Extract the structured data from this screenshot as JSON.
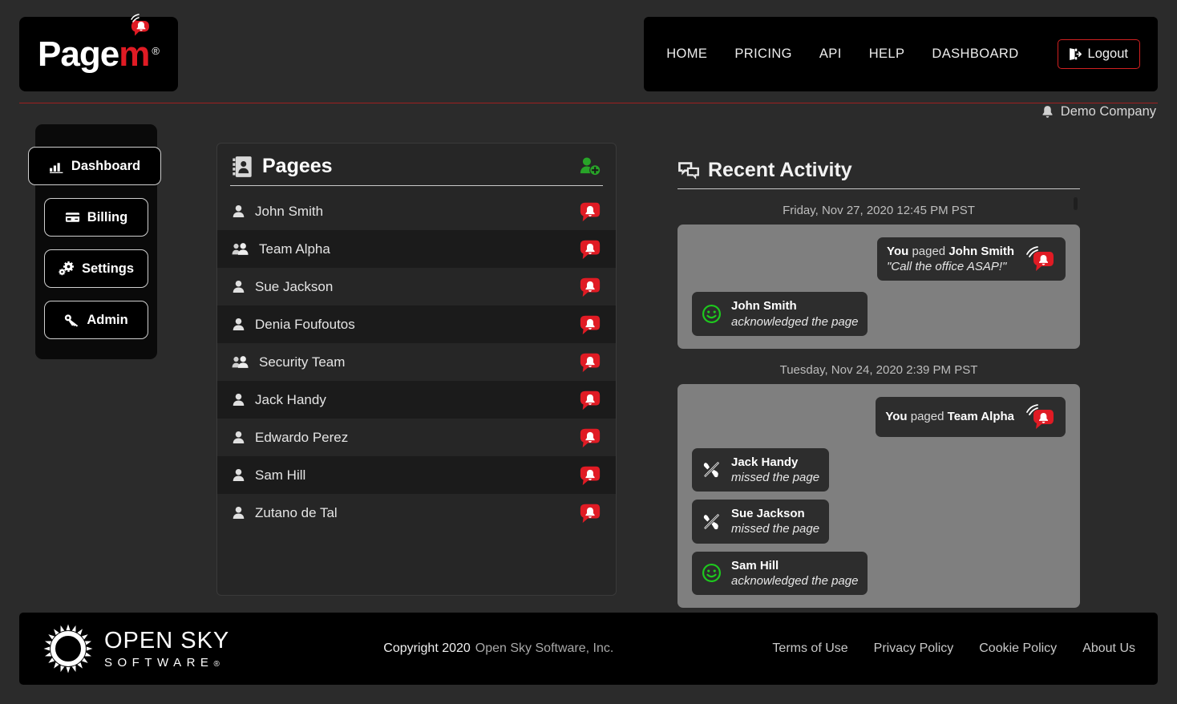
{
  "brand": {
    "logo_text": "Page",
    "logo_accent": "m",
    "logo_registered": "®",
    "accent_color": "#e01b24"
  },
  "nav": {
    "links": [
      {
        "label": "HOME"
      },
      {
        "label": "PRICING"
      },
      {
        "label": "API"
      },
      {
        "label": "HELP"
      },
      {
        "label": "DASHBOARD"
      }
    ],
    "logout_label": "Logout",
    "logout_icon": "sign-out-icon",
    "logout_border_color": "#d02020"
  },
  "account": {
    "bell_icon": "bell-icon",
    "company": "Demo Company"
  },
  "sidebar": {
    "items": [
      {
        "label": "Dashboard",
        "icon": "chart-bar-icon",
        "active": true
      },
      {
        "label": "Billing",
        "icon": "credit-card-icon",
        "active": false
      },
      {
        "label": "Settings",
        "icon": "gears-icon",
        "active": false
      },
      {
        "label": "Admin",
        "icon": "key-icon",
        "active": false
      }
    ]
  },
  "pagees": {
    "title": "Pagees",
    "title_icon": "address-book-icon",
    "add_icon": "add-user-icon",
    "add_icon_color": "#28a428",
    "page_icon": "page-bell-bubble-icon",
    "page_icon_color": "#e01b24",
    "rows": [
      {
        "name": "John Smith",
        "type": "user"
      },
      {
        "name": "Team Alpha",
        "type": "team"
      },
      {
        "name": "Sue Jackson",
        "type": "user"
      },
      {
        "name": "Denia Foufoutos",
        "type": "user"
      },
      {
        "name": "Security Team",
        "type": "team"
      },
      {
        "name": "Jack Handy",
        "type": "user"
      },
      {
        "name": "Edwardo Perez",
        "type": "user"
      },
      {
        "name": "Sam Hill",
        "type": "user"
      },
      {
        "name": "Zutano de Tal",
        "type": "user"
      }
    ]
  },
  "activity": {
    "title": "Recent Activity",
    "title_icon": "comments-icon",
    "cards": [
      {
        "date": "Friday, Nov 27, 2020 12:45 PM PST",
        "events": [
          {
            "align": "right",
            "actor": "You",
            "verb": "paged",
            "target": "John Smith",
            "message": "\"Call the office ASAP!\"",
            "icon": "page-bell-bubble-icon"
          },
          {
            "align": "left",
            "name": "John Smith",
            "status": "acknowledged the page",
            "icon": "smiley-icon",
            "icon_color": "#1ec81e"
          }
        ]
      },
      {
        "date": "Tuesday, Nov 24, 2020 2:39 PM PST",
        "events": [
          {
            "align": "right",
            "actor": "You",
            "verb": "paged",
            "target": "Team Alpha",
            "message": "",
            "icon": "page-bell-bubble-icon"
          },
          {
            "align": "left",
            "name": "Jack Handy",
            "status": "missed the page",
            "icon": "phone-slash-icon",
            "icon_color": "#ffffff"
          },
          {
            "align": "left",
            "name": "Sue Jackson",
            "status": "missed the page",
            "icon": "phone-slash-icon",
            "icon_color": "#ffffff"
          },
          {
            "align": "left",
            "name": "Sam Hill",
            "status": "acknowledged the page",
            "icon": "smiley-icon",
            "icon_color": "#1ec81e"
          }
        ]
      }
    ]
  },
  "footer": {
    "logo_line1": "OPEN SKY",
    "logo_line2": "SOFTWARE",
    "logo_registered": "®",
    "copyright": "Copyright 2020",
    "company": "Open Sky Software, Inc.",
    "links": [
      {
        "label": "Terms of Use"
      },
      {
        "label": "Privacy Policy"
      },
      {
        "label": "Cookie Policy"
      },
      {
        "label": "About Us"
      }
    ]
  }
}
